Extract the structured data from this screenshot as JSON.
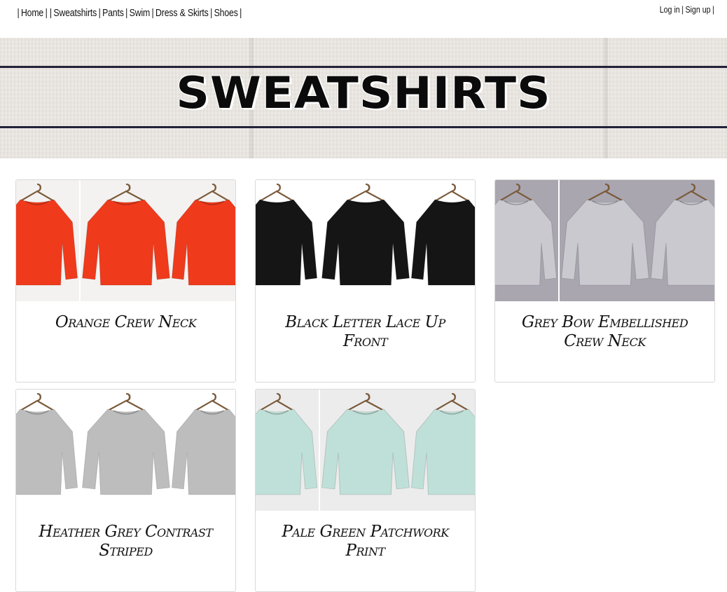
{
  "nav": {
    "items": [
      "Home",
      "Sweatshirts",
      "Pants",
      "Swim",
      "Dress & Skirts",
      "Shoes"
    ]
  },
  "auth": {
    "login": "Log in",
    "signup": "Sign up"
  },
  "banner": {
    "title": "SWEATSHIRTS"
  },
  "products": [
    {
      "title": "Orange Crew Neck",
      "color": "#f03a1c",
      "bg": "#f4f2f0"
    },
    {
      "title": "Black Letter Lace Up Front",
      "color": "#151515",
      "bg": "#ffffff"
    },
    {
      "title": "Grey Bow Embellished Crew Neck",
      "color": "#c9c9cf",
      "bg": "#a9a6b0"
    },
    {
      "title": "Heather Grey Contrast Striped",
      "color": "#bdbdbd",
      "bg": "#ffffff"
    },
    {
      "title": "Pale Green Patchwork Print",
      "color": "#bfe0d8",
      "bg": "#ececec"
    }
  ]
}
